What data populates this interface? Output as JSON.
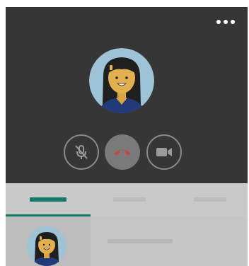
{
  "colors": {
    "call_background": "#363636",
    "accent_green": "#127a68",
    "hangup_red": "#c4473f",
    "icon_gray": "#8a8a8a",
    "tab_bar_bg": "#c9c9c9",
    "placeholder_bar": "#bcbcbc",
    "list_bg": "#c6c6c6",
    "list_avatar_cell_bg": "#bdbdbd"
  },
  "call": {
    "more_icon": "more-horizontal-icon",
    "caller_avatar": "avatar-woman-icon",
    "controls": [
      {
        "name": "mute",
        "icon": "microphone-off-icon"
      },
      {
        "name": "hang-up",
        "icon": "phone-hangup-icon"
      },
      {
        "name": "video",
        "icon": "video-camera-icon"
      }
    ]
  },
  "tabs": {
    "count": 3,
    "selected_index": 0
  },
  "list": {
    "items": [
      {
        "avatar": "avatar-woman-icon"
      }
    ]
  }
}
